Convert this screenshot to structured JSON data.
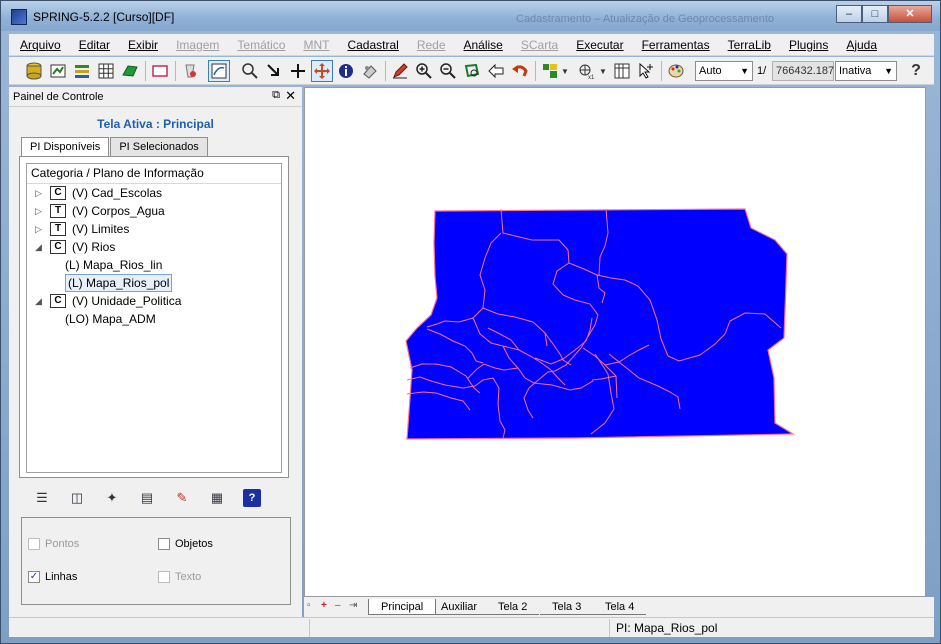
{
  "window": {
    "title": "SPRING-5.2.2 [Curso][DF]",
    "ghost_title": "Cadastramento – Atualização de Geoprocessamento",
    "controls": [
      "minimize",
      "maximize",
      "close"
    ]
  },
  "menu": [
    {
      "label": "Arquivo",
      "enabled": true
    },
    {
      "label": "Editar",
      "enabled": true
    },
    {
      "label": "Exibir",
      "enabled": true
    },
    {
      "label": "Imagem",
      "enabled": false
    },
    {
      "label": "Temático",
      "enabled": false
    },
    {
      "label": "MNT",
      "enabled": false
    },
    {
      "label": "Cadastral",
      "enabled": true
    },
    {
      "label": "Rede",
      "enabled": false
    },
    {
      "label": "Análise",
      "enabled": true
    },
    {
      "label": "SCarta",
      "enabled": false
    },
    {
      "label": "Executar",
      "enabled": true
    },
    {
      "label": "Ferramentas",
      "enabled": true
    },
    {
      "label": "TerraLib",
      "enabled": true
    },
    {
      "label": "Plugins",
      "enabled": true
    },
    {
      "label": "Ajuda",
      "enabled": true
    }
  ],
  "toolbar": {
    "zoom_mode": "Auto",
    "scale_prefix": "1/",
    "scale_value": "766432.187",
    "state_combo": "Inativa"
  },
  "panel": {
    "title": "Painel de Controle",
    "active_screen": "Tela Ativa : Principal",
    "tabs": [
      "PI Disponíveis",
      "PI Selecionados"
    ],
    "tree_header": "Categoria / Plano de Informação",
    "tree": [
      {
        "type": "category",
        "cat_letter": "C",
        "label": "(V) Cad_Escolas",
        "expanded": false
      },
      {
        "type": "category",
        "cat_letter": "T",
        "label": "(V) Corpos_Agua",
        "expanded": false
      },
      {
        "type": "category",
        "cat_letter": "T",
        "label": "(V) Limites",
        "expanded": false
      },
      {
        "type": "category",
        "cat_letter": "C",
        "label": "(V) Rios",
        "expanded": true
      },
      {
        "type": "leaf",
        "label": "(L) Mapa_Rios_lin",
        "selected": false
      },
      {
        "type": "leaf",
        "label": "(L) Mapa_Rios_pol",
        "selected": true
      },
      {
        "type": "category",
        "cat_letter": "C",
        "label": "(V) Unidade_Politica",
        "expanded": true
      },
      {
        "type": "leaf",
        "label": "(LO) Mapa_ADM",
        "selected": false
      }
    ],
    "options": {
      "points": {
        "label": "Pontos",
        "checked": false,
        "enabled": false
      },
      "objects": {
        "label": "Objetos",
        "checked": false,
        "enabled": true
      },
      "lines": {
        "label": "Linhas",
        "checked": true,
        "enabled": true
      },
      "text": {
        "label": "Texto",
        "checked": false,
        "enabled": false
      }
    }
  },
  "screen_tabs": [
    {
      "label": "Principal",
      "selected": true
    },
    {
      "label": "Auxiliar",
      "selected": false
    },
    {
      "label": "Tela 2",
      "selected": false
    },
    {
      "label": "Tela 3",
      "selected": false
    },
    {
      "label": "Tela 4",
      "selected": false
    }
  ],
  "status": {
    "text": "PI: Mapa_Rios_pol"
  },
  "map_colors": {
    "fill": "#0000ff",
    "border": "#ff6f8f"
  }
}
